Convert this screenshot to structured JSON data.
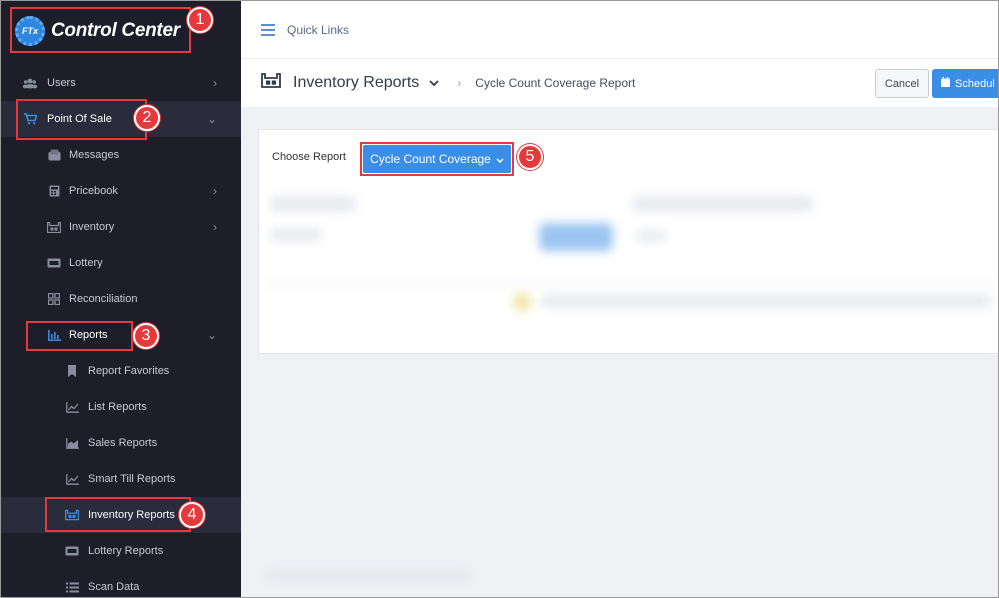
{
  "logo": {
    "badge": "FTx",
    "text": "Control Center"
  },
  "sidebar": {
    "items": [
      {
        "label": "Users",
        "icon": "users-icon"
      },
      {
        "label": "Point Of Sale",
        "icon": "cart-icon"
      },
      {
        "label": "Messages",
        "icon": "messages-icon"
      },
      {
        "label": "Pricebook",
        "icon": "calculator-icon"
      },
      {
        "label": "Inventory",
        "icon": "warehouse-icon"
      },
      {
        "label": "Lottery",
        "icon": "ticket-icon"
      },
      {
        "label": "Reconciliation",
        "icon": "grid-icon"
      },
      {
        "label": "Reports",
        "icon": "bar-chart-icon"
      },
      {
        "label": "Report Favorites",
        "icon": "bookmark-icon"
      },
      {
        "label": "List Reports",
        "icon": "line-chart-icon"
      },
      {
        "label": "Sales Reports",
        "icon": "area-chart-icon"
      },
      {
        "label": "Smart Till Reports",
        "icon": "line-chart-icon"
      },
      {
        "label": "Inventory Reports",
        "icon": "warehouse-icon"
      },
      {
        "label": "Lottery Reports",
        "icon": "ticket-icon"
      },
      {
        "label": "Scan Data",
        "icon": "list-icon"
      }
    ]
  },
  "topbar": {
    "quick_links": "Quick Links"
  },
  "header": {
    "title": "Inventory Reports",
    "breadcrumb": "Cycle Count Coverage Report",
    "cancel": "Cancel",
    "schedule": "Schedul"
  },
  "main": {
    "choose_label": "Choose Report",
    "report_select": "Cycle Count Coverage"
  },
  "callouts": [
    "1",
    "2",
    "3",
    "4",
    "5"
  ],
  "colors": {
    "accent": "#3a8ee6",
    "callout": "#e5393c",
    "sidebar": "#1d1e2a"
  }
}
